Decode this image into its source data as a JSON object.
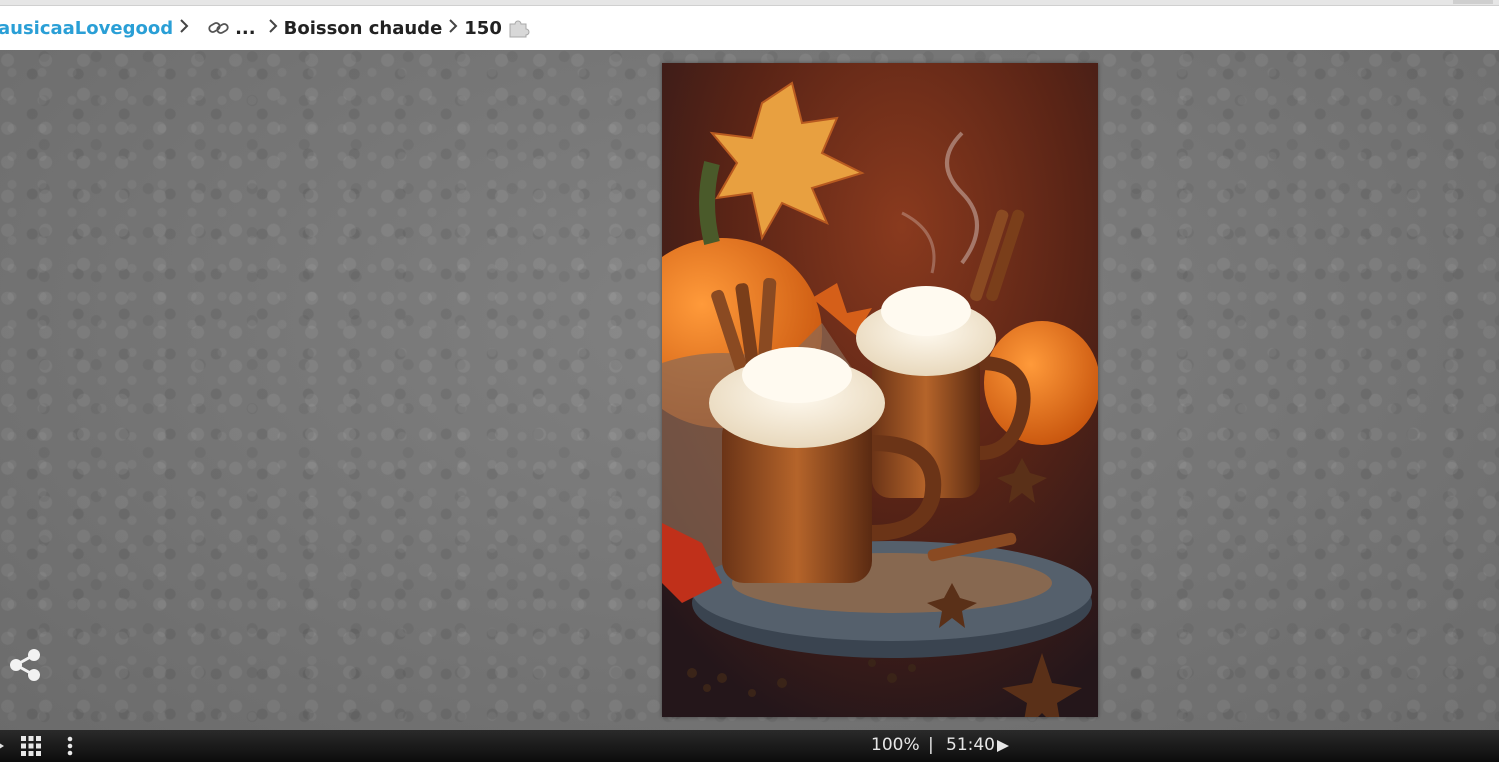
{
  "breadcrumb": {
    "user": "ausicaaLovegood",
    "ellipsis": "...",
    "category": "Boisson chaude",
    "piece_count": "150"
  },
  "icons": {
    "link": "link-icon",
    "puzzle": "puzzle-piece-icon",
    "share": "share-icon",
    "grid": "grid-icon",
    "menu": "more-vertical-icon",
    "play": "play-icon"
  },
  "status": {
    "zoom": "100%",
    "divider": "|",
    "timer": "51:40"
  },
  "colors": {
    "user_link": "#2a9fd6",
    "background_texture": "#7a7a7a",
    "status_bar": "#1a1a1a"
  }
}
